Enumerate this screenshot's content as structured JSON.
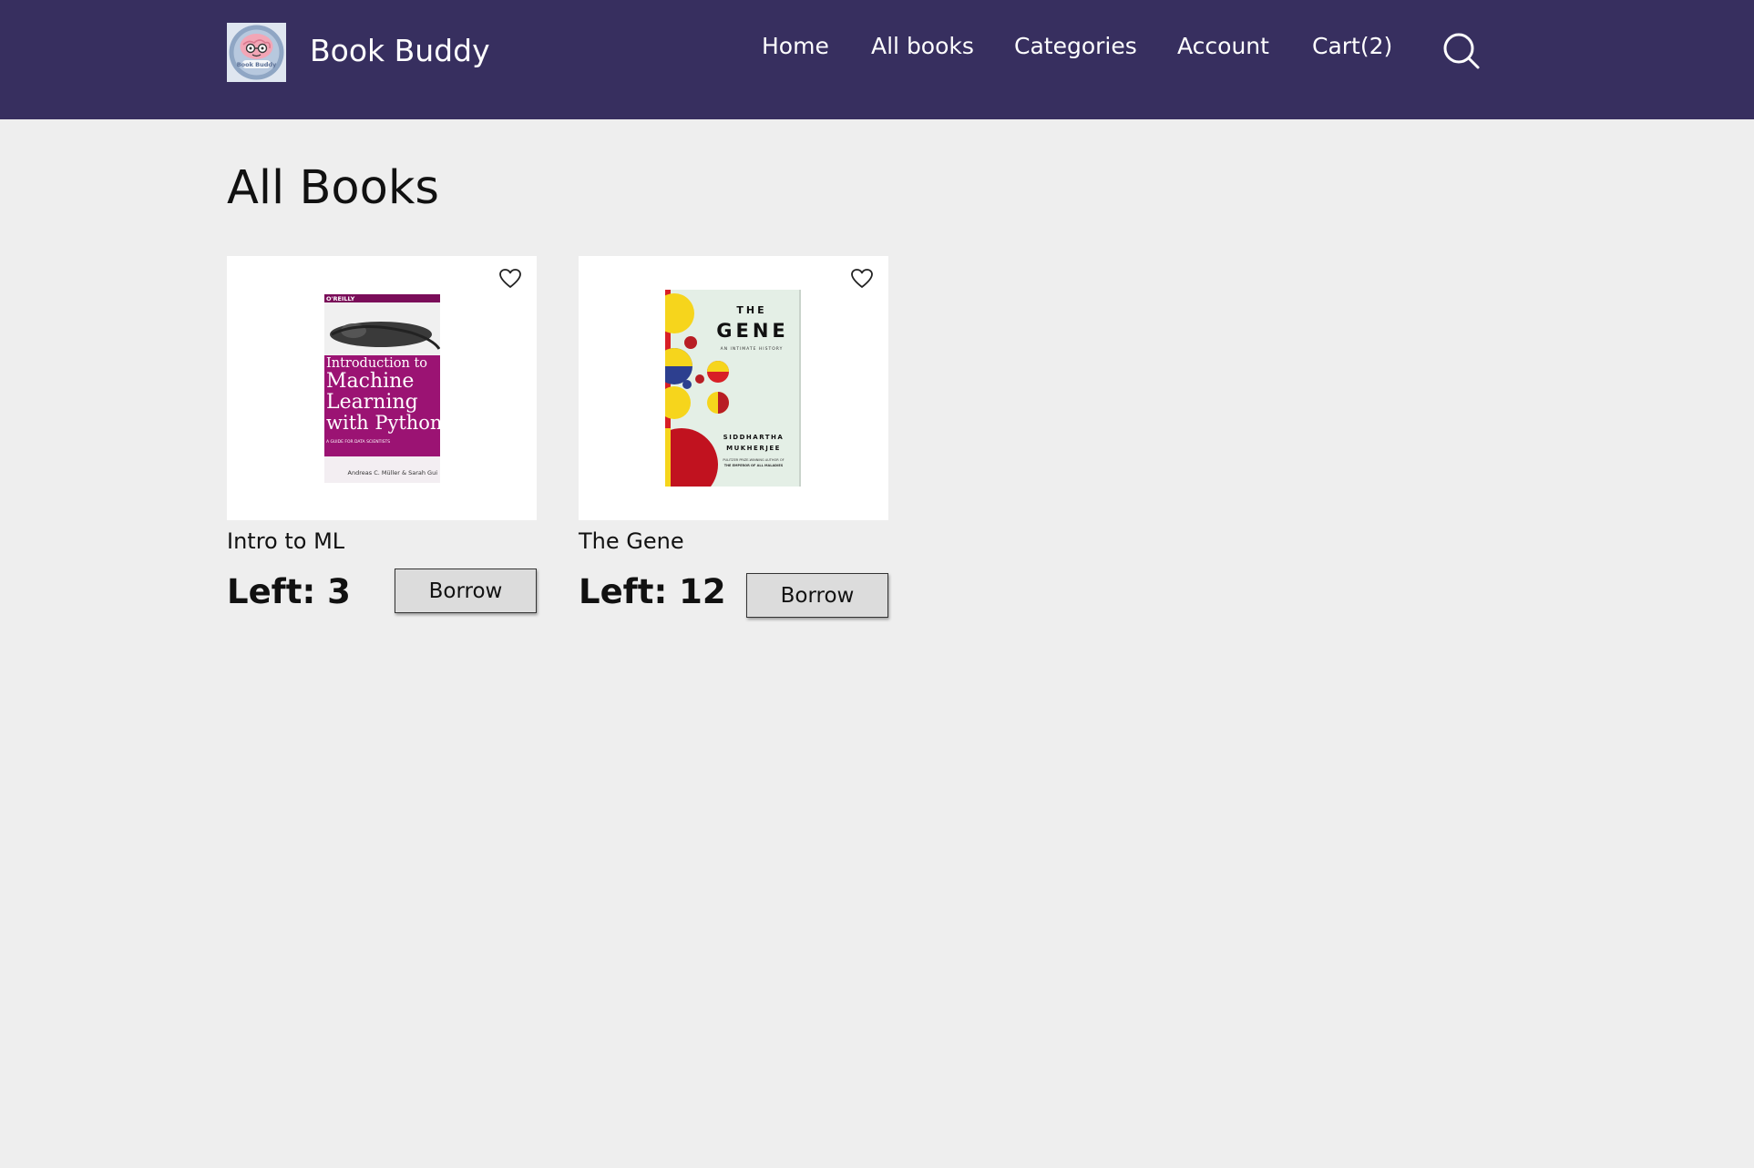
{
  "header": {
    "brand": "Book Buddy",
    "logo_text": "Book Buddy",
    "nav": [
      {
        "label": "Home"
      },
      {
        "label": "All books"
      },
      {
        "label": "Categories"
      },
      {
        "label": "Account"
      },
      {
        "label": "Cart(2)"
      }
    ],
    "search_icon": "search-icon"
  },
  "main": {
    "title": "All Books",
    "books": [
      {
        "title": "Intro to ML",
        "left": "Left: 3",
        "borrow_label": "Borrow",
        "favorite_icon": "heart-outline-icon",
        "cover": {
          "publisher": "O'REILLY",
          "lines": [
            "Introduction to",
            "Machine",
            "Learning",
            "with Python"
          ],
          "subtitle": "A GUIDE FOR DATA SCIENTISTS",
          "authors": "Andreas C. Müller & Sarah Gui",
          "color": "#9b1373"
        }
      },
      {
        "title": "The Gene",
        "left": "Left: 12",
        "borrow_label": "Borrow",
        "favorite_icon": "heart-outline-icon",
        "cover": {
          "top": "THE",
          "big": "GENE",
          "subtitle": "AN INTIMATE HISTORY",
          "author1": "SIDDHARTHA",
          "author2": "MUKHERJEE",
          "blurb1": "PULITZER PRIZE-WINNING AUTHOR OF",
          "blurb2": "THE EMPEROR OF ALL MALADIES",
          "color": "#e4efe6"
        }
      }
    ]
  },
  "colors": {
    "header_bg": "#372f5f",
    "page_bg": "#eeeeee",
    "button_bg": "#dcdcdc"
  }
}
